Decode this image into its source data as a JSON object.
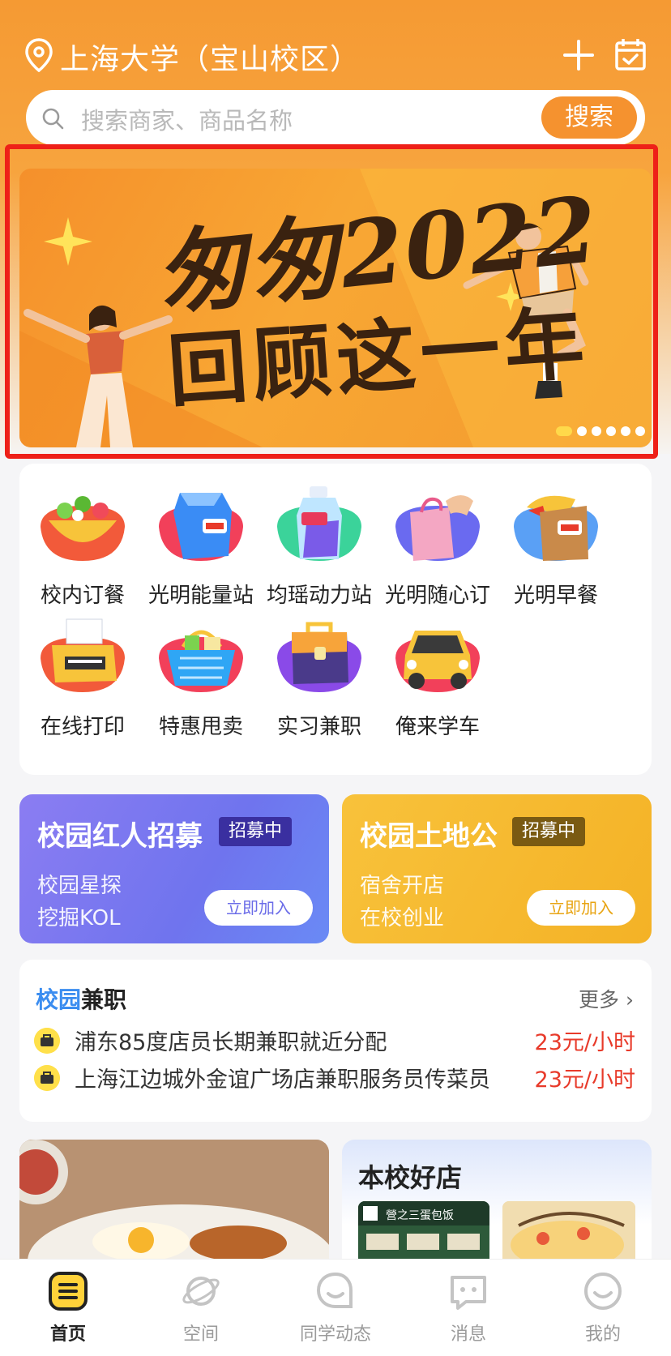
{
  "header": {
    "location": "上海大学（宝山校区）",
    "icons": [
      "location-pin-icon",
      "plus-icon",
      "calendar-check-icon"
    ]
  },
  "search": {
    "placeholder": "搜索商家、商品名称",
    "button": "搜索"
  },
  "banner": {
    "line1": "匆匆2022",
    "line2": "回顾这一年",
    "page_count": 6,
    "active_page": 1
  },
  "categories": [
    {
      "label": "校内订餐",
      "icon": "food-bowl-icon"
    },
    {
      "label": "光明能量站",
      "icon": "milk-carton-icon"
    },
    {
      "label": "均瑶动力站",
      "icon": "drink-bottle-icon"
    },
    {
      "label": "光明随心订",
      "icon": "shopping-bag-icon"
    },
    {
      "label": "光明早餐",
      "icon": "bread-bag-icon"
    },
    {
      "label": "在线打印",
      "icon": "printer-icon"
    },
    {
      "label": "特惠甩卖",
      "icon": "shopping-basket-icon"
    },
    {
      "label": "实习兼职",
      "icon": "briefcase-icon"
    },
    {
      "label": "俺来学车",
      "icon": "car-icon"
    }
  ],
  "promos": [
    {
      "title": "校园红人招募",
      "tag": "招募中",
      "line1": "校园星探",
      "line2": "挖掘KOL",
      "button": "立即加入"
    },
    {
      "title": "校园土地公",
      "tag": "招募中",
      "line1": "宿舍开店",
      "line2": "在校创业",
      "button": "立即加入"
    }
  ],
  "jobs": {
    "title_highlight": "校园",
    "title_rest": "兼职",
    "more": "更多 ›",
    "items": [
      {
        "title": "浦东85度店员长期兼职就近分配",
        "pay": "23元/小时"
      },
      {
        "title": "上海江边城外金谊广场店兼职服务员传菜员",
        "pay": "23元/小时"
      }
    ]
  },
  "shops": {
    "title": "本校好店",
    "sign_text": "營之三蛋包饭"
  },
  "tabbar": [
    {
      "label": "首页",
      "icon": "home-icon",
      "active": true
    },
    {
      "label": "空间",
      "icon": "planet-icon",
      "active": false
    },
    {
      "label": "同学动态",
      "icon": "smile-bubble-icon",
      "active": false
    },
    {
      "label": "消息",
      "icon": "message-icon",
      "active": false
    },
    {
      "label": "我的",
      "icon": "profile-icon",
      "active": false
    }
  ],
  "colors": {
    "brand_orange": "#f5922f",
    "banner_border": "#ee2018",
    "price_red": "#e83a2a",
    "promo_purple": "#6f74ee",
    "promo_yellow": "#f4b226"
  }
}
